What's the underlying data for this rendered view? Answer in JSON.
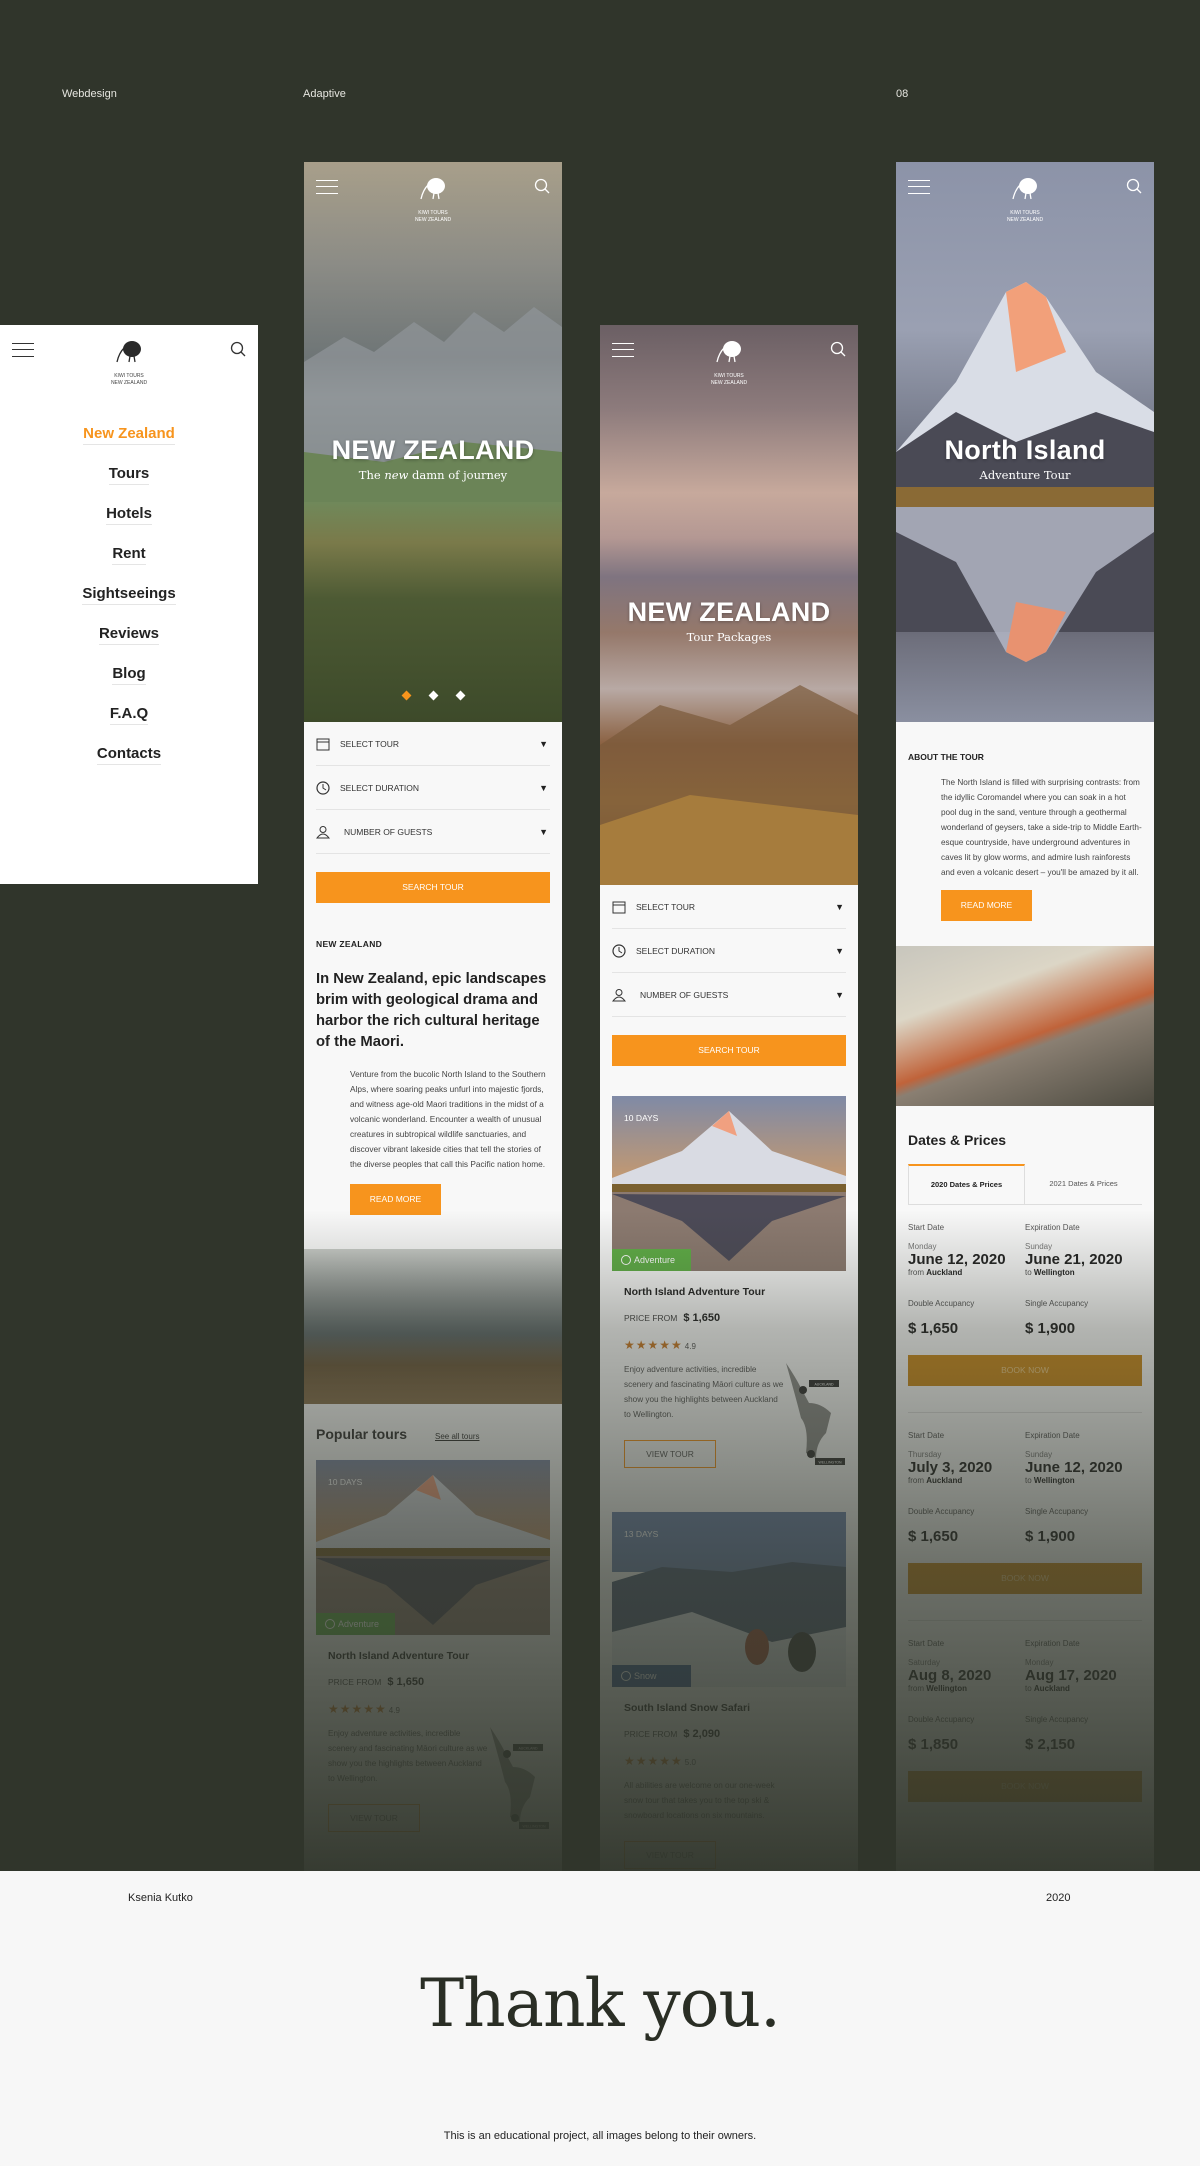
{
  "labels": {
    "left": "Webdesign",
    "middle": "Adaptive",
    "right": "08"
  },
  "brand": {
    "line1": "KIWI TOURS",
    "line2": "NEW ZEALAND"
  },
  "menu": {
    "items": [
      "New Zealand",
      "Tours",
      "Hotels",
      "Rent",
      "Sightseeings",
      "Reviews",
      "Blog",
      "F.A.Q",
      "Contacts"
    ],
    "active": "New Zealand",
    "accent": "#f7941d"
  },
  "form": {
    "tour": "SELECT TOUR",
    "duration": "SELECT DURATION",
    "guests": "NUMBER OF GUESTS",
    "search": "SEARCH TOUR"
  },
  "phone_a": {
    "hero": {
      "title": "NEW ZEALAND",
      "subtitle_pre": "The ",
      "subtitle_em": "new",
      "subtitle_post": " damn of journey",
      "slides": 3,
      "active_slide": 1
    },
    "section_label": "NEW ZEALAND",
    "heading": "In New Zealand, epic landscapes brim with geological drama and harbor the rich cultural heritage of the Maori.",
    "paragraph": "Venture from the bucolic North Island to the Southern Alps, where soaring peaks unfurl into majestic fjords, and witness age-old Maori traditions in the midst of a volcanic wonderland. Encounter a wealth of unusual creatures in subtropical wildlife sanctuaries, and discover vibrant lakeside cities that tell the stories of the diverse peoples that call this Pacific nation home.",
    "read_more": "READ MORE",
    "popular": {
      "title": "Popular tours",
      "link": "See all tours"
    }
  },
  "tours": [
    {
      "days": "10 DAYS",
      "tag": "Adventure",
      "title": "North Island Adventure Tour",
      "price_label": "PRICE FROM",
      "price": "$ 1,650",
      "stars": "★★★★★",
      "rating": "4.9",
      "desc": "Enjoy adventure activities, incredible scenery and fascinating Māori culture as we show you the highlights between Auckland to Wellington.",
      "view": "VIEW TOUR",
      "map_from": "AUCKLAND",
      "map_to": "WELLINGTON"
    },
    {
      "days": "13 DAYS",
      "tag": "Snow",
      "title": "South Island Snow Safari",
      "price_label": "PRICE FROM",
      "price": "$ 2,090",
      "stars": "★★★★★",
      "rating": "5.0",
      "desc": "All abilities are welcome on our one-week snow tour that takes you to the top ski & snowboard locations on six mountains.",
      "view": "VIEW TOUR"
    }
  ],
  "phone_b": {
    "hero": {
      "title": "NEW ZEALAND",
      "subtitle": "Tour Packages"
    }
  },
  "phone_c": {
    "hero": {
      "title": "North Island",
      "subtitle": "Adventure Tour"
    },
    "about": {
      "label": "ABOUT THE TOUR",
      "text": "The North Island is filled with surprising contrasts: from the idyllic Coromandel where you can soak in a hot pool dug in the sand, venture through a geothermal wonderland of geysers, take a side-trip to Middle Earth-esque countryside, have underground adventures in caves lit by glow worms, and admire lush rainforests and even a volcanic desert – you'll be amazed by it all.",
      "read_more": "READ MORE"
    },
    "dates": {
      "title": "Dates & Prices",
      "tabs": [
        "2020 Dates & Prices",
        "2021 Dates & Prices"
      ],
      "start_label": "Start Date",
      "end_label": "Expiration Date",
      "double_label": "Double Accupancy",
      "single_label": "Single Accupancy",
      "book": "BOOK NOW",
      "entries": [
        {
          "start_day": "Monday",
          "start": "June 12, 2020",
          "from": "Auckland",
          "end_day": "Sunday",
          "end": "June 21, 2020",
          "to": "Wellington",
          "double": "$ 1,650",
          "single": "$ 1,900"
        },
        {
          "start_day": "Thursday",
          "start": "July 3, 2020",
          "from": "Auckland",
          "end_day": "Sunday",
          "end": "June 12, 2020",
          "to": "Wellington",
          "double": "$ 1,650",
          "single": "$ 1,900"
        },
        {
          "start_day": "Saturday",
          "start": "Aug 8, 2020",
          "from": "Wellington",
          "end_day": "Monday",
          "end": "Aug 17, 2020",
          "to": "Auckland",
          "double": "$ 1,850",
          "single": "$ 2,150"
        }
      ],
      "from_word": "from",
      "to_word": "to"
    }
  },
  "footer": {
    "author": "Ksenia Kutko",
    "year": "2020",
    "thanks": "Thank you.",
    "note": "This is an educational project, all images belong to their owners."
  }
}
